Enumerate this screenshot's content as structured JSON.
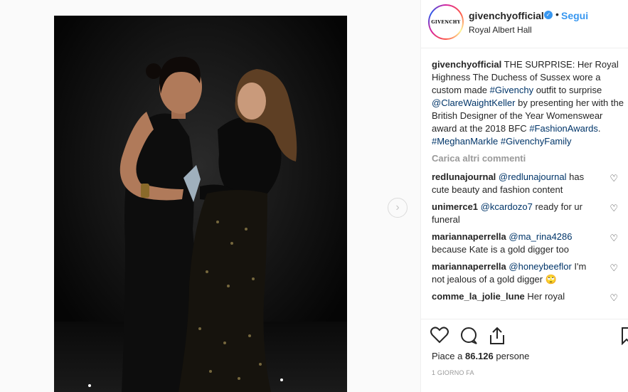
{
  "post": {
    "image_alt": "Photo",
    "next_icon": "chevron-right-icon"
  },
  "header": {
    "avatar_text": "GIVENCHY",
    "username": "givenchyofficial",
    "verified_icon": "verified-badge-icon",
    "separator": "•",
    "follow_label": "Segui",
    "location": "Royal Albert Hall"
  },
  "caption": {
    "username": "givenchyofficial",
    "text_1": " THE SURPRISE: Her Royal Highness The Duchess of Sussex wore a custom made ",
    "tag_1": "#Givenchy",
    "text_2": " outfit to surprise ",
    "tag_2": "@ClareWaightKeller",
    "text_3": " by presenting her with the British Designer of the Year Womenswear award at the 2018 BFC ",
    "tag_3": "#FashionAwards",
    "text_4": ". ",
    "tag_4": "#MeghanMarkle",
    "text_5": " ",
    "tag_5": "#GivenchyFamily"
  },
  "load_more": "Carica altri commenti",
  "comments": [
    {
      "user": "redlunajournal",
      "mention": "@redlunajournal",
      "text": " has cute beauty and fashion content"
    },
    {
      "user": "unimerce1",
      "mention": "@kcardozo7",
      "text": " ready for ur funeral"
    },
    {
      "user": "mariannaperrella",
      "mention": "@ma_rina4286",
      "text": " because Kate is a gold digger too"
    },
    {
      "user": "mariannaperrella",
      "mention": "@honeybeeflor",
      "text": " I'm not jealous of a gold digger 🙄"
    },
    {
      "user": "comme_la_jolie_lune",
      "mention": "",
      "text": " Her royal"
    }
  ],
  "actions": {
    "like_icon": "heart-icon",
    "comment_icon": "comment-icon",
    "share_icon": "share-icon",
    "save_icon": "bookmark-icon"
  },
  "likes": {
    "prefix": "Piace a ",
    "count": "86.126",
    "suffix": " persone"
  },
  "timestamp": "1 GIORNO FA"
}
